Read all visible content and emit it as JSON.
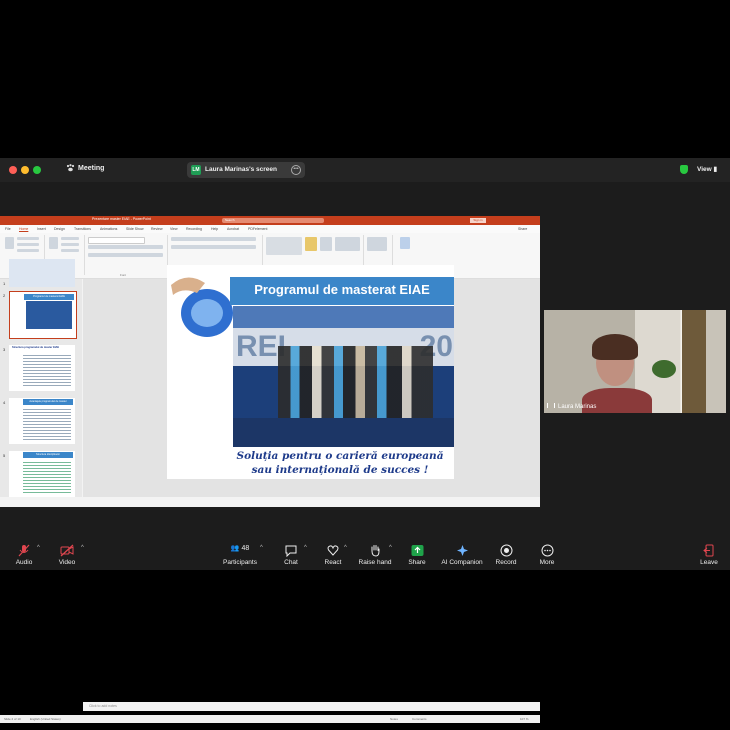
{
  "window": {
    "title": "Meeting",
    "share_label": "Laura Marinas's screen",
    "share_badge": "LM",
    "view_label": "View"
  },
  "powerpoint": {
    "title": "Prezentare master EIAE - PowerPoint",
    "search_placeholder": "Search",
    "sign_in": "Sign in",
    "menu": [
      "File",
      "Home",
      "Insert",
      "Design",
      "Transitions",
      "Animations",
      "Slide Show",
      "Review",
      "View",
      "Recording",
      "Help",
      "Acrobat",
      "PDFelement"
    ],
    "ribbon_groups": [
      "Clipboard",
      "Slides",
      "Font",
      "Paragraph",
      "Drawing",
      "Editing",
      "Create a PDF"
    ],
    "share_button": "Share",
    "notes_placeholder": "Click to add notes",
    "status_left": "Slide 2 of 10",
    "status_lang": "English (United States)",
    "status_notes": "Notes",
    "status_comments": "Comments",
    "zoom": "107 %"
  },
  "slide": {
    "title": "Programul de masterat EIAE",
    "subtitle_line1": "Soluția pentru o carieră europeană",
    "subtitle_line2": "sau internațională de succes !",
    "banner_text": "REI",
    "banner_text_right": "20"
  },
  "thumbnails": [
    {
      "num": "1"
    },
    {
      "num": "2",
      "title": "Programul de masterat EIAE"
    },
    {
      "num": "3",
      "title": "Structura programului de master EIAE"
    },
    {
      "num": "4",
      "title": "Avantajele programului de master"
    },
    {
      "num": "5",
      "title": "Structura disciplinelor"
    }
  ],
  "video": {
    "participant_name": "Laura Marinas"
  },
  "toolbar": {
    "audio": "Audio",
    "video": "Video",
    "participants": "Participants",
    "participants_count": "48",
    "chat": "Chat",
    "react": "React",
    "raise_hand": "Raise hand",
    "share": "Share",
    "ai_companion": "AI Companion",
    "record": "Record",
    "more": "More",
    "leave": "Leave"
  },
  "colors": {
    "ppt_accent": "#c43e1c",
    "slide_header": "#3b86c9",
    "share_green": "#1fa34a",
    "mute_red": "#e0464f"
  }
}
